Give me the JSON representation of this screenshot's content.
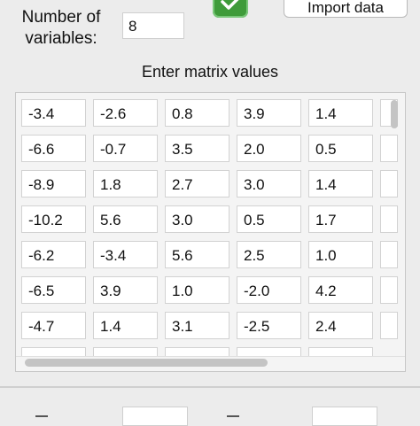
{
  "header": {
    "variables_label_line1": "Number of",
    "variables_label_line2": "variables:",
    "variables_value": "8",
    "import_label": "Import data"
  },
  "matrix": {
    "title": "Enter matrix values",
    "rows": [
      [
        "-3.4",
        "-2.6",
        "0.8",
        "3.9",
        "1.4"
      ],
      [
        "-6.6",
        "-0.7",
        "3.5",
        "2.0",
        "0.5"
      ],
      [
        "-8.9",
        "1.8",
        "2.7",
        "3.0",
        "1.4"
      ],
      [
        "-10.2",
        "5.6",
        "3.0",
        "0.5",
        "1.7"
      ],
      [
        "-6.2",
        "-3.4",
        "5.6",
        "2.5",
        "1.0"
      ],
      [
        "-6.5",
        "3.9",
        "1.0",
        "-2.0",
        "4.2"
      ],
      [
        "-4.7",
        "1.4",
        "3.1",
        "-2.5",
        "2.4"
      ]
    ]
  },
  "colors": {
    "accent_green": "#3f9b3a",
    "background": "#ececec"
  }
}
